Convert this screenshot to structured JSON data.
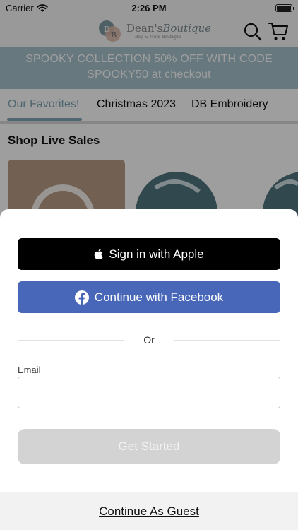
{
  "status_bar": {
    "carrier": "Carrier",
    "time": "2:26 PM",
    "wifi_icon": "wifi-icon",
    "battery_icon": "battery-icon"
  },
  "header": {
    "logo": {
      "name": "Dean's",
      "script": "Boutique",
      "tagline": "Boy & Mom Boutique",
      "monogram": "DB"
    },
    "search_icon": "search-icon",
    "cart_icon": "cart-icon"
  },
  "promo": {
    "text": "SPOOKY COLLECTION 50% OFF WITH  CODE SPOOKY50 at checkout"
  },
  "tabs": {
    "items": [
      {
        "label": "Our Favorites!",
        "active": true
      },
      {
        "label": "Christmas 2023",
        "active": false
      },
      {
        "label": "DB Embroidery",
        "active": false
      }
    ]
  },
  "shop_live": {
    "title": "Shop Live Sales",
    "play_icon": "play-icon"
  },
  "sheet": {
    "apple_button": "Sign in with Apple",
    "facebook_button": "Continue with Facebook",
    "or_text": "Or",
    "email_label": "Email",
    "email_value": "",
    "email_placeholder": "",
    "get_started_button": "Get Started",
    "guest_link": "Continue As Guest"
  },
  "colors": {
    "brand_teal": "#7fa5b3",
    "promo_bg": "#a7c2cb",
    "facebook_blue": "#4867b9",
    "apple_black": "#000000",
    "disabled_button": "#d3d3d3"
  }
}
